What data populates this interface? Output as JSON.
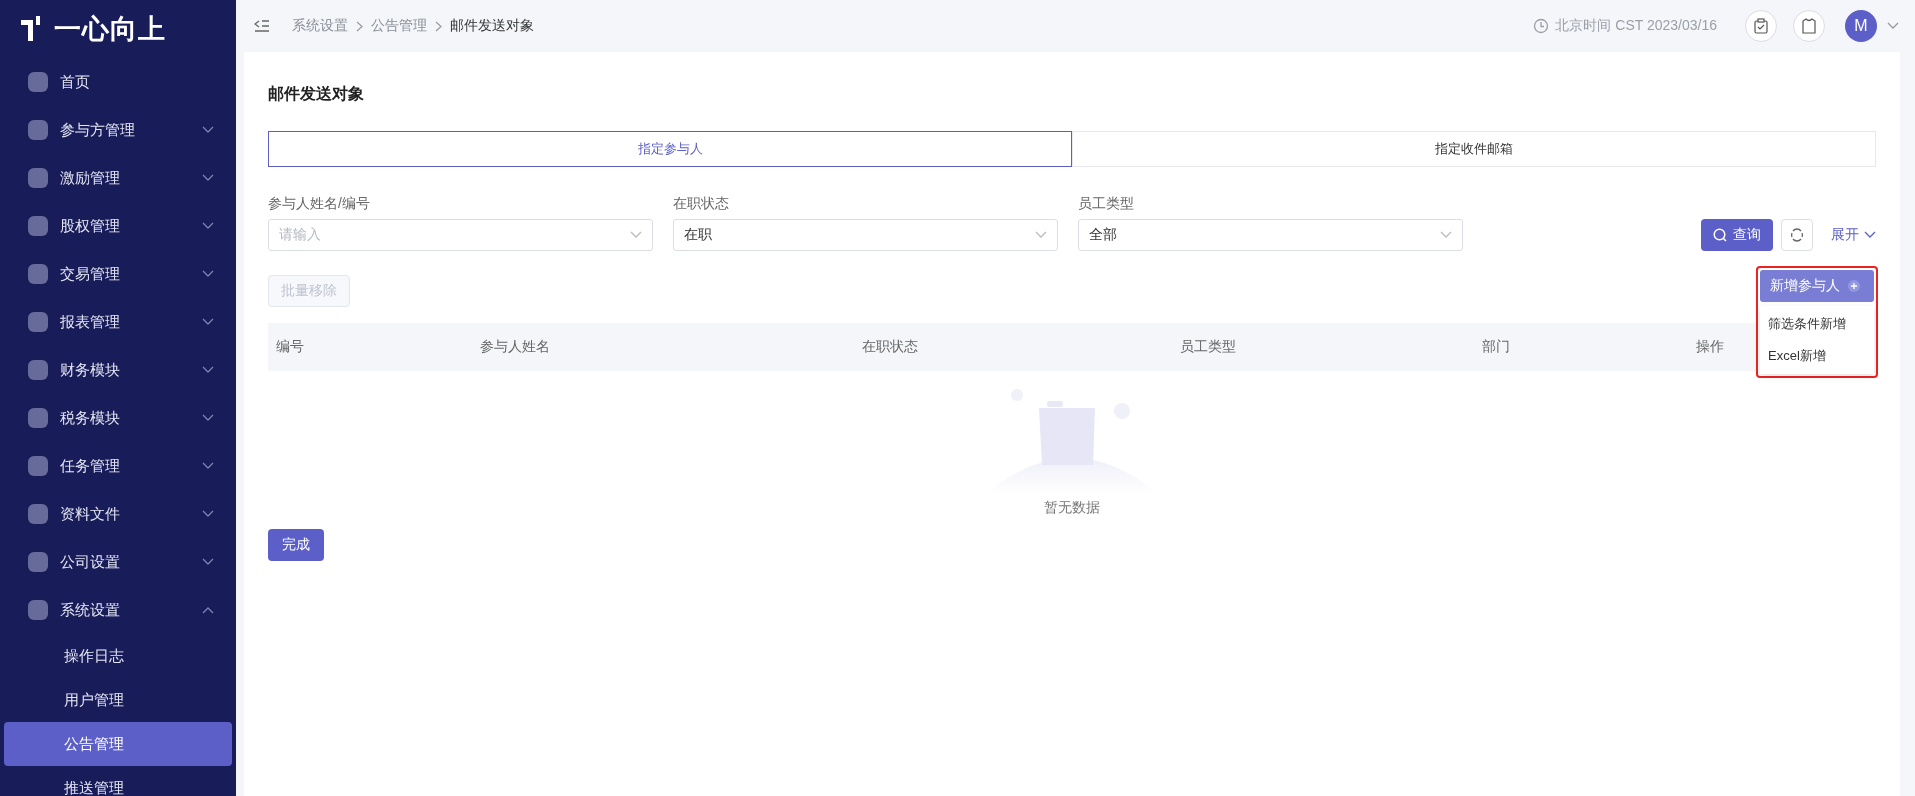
{
  "logo": {
    "text": "一心向上"
  },
  "sidebar": {
    "items": [
      {
        "label": "首页",
        "expandable": false
      },
      {
        "label": "参与方管理",
        "expandable": true,
        "expanded": false
      },
      {
        "label": "激励管理",
        "expandable": true,
        "expanded": false
      },
      {
        "label": "股权管理",
        "expandable": true,
        "expanded": false
      },
      {
        "label": "交易管理",
        "expandable": true,
        "expanded": false
      },
      {
        "label": "报表管理",
        "expandable": true,
        "expanded": false
      },
      {
        "label": "财务模块",
        "expandable": true,
        "expanded": false
      },
      {
        "label": "税务模块",
        "expandable": true,
        "expanded": false
      },
      {
        "label": "任务管理",
        "expandable": true,
        "expanded": false
      },
      {
        "label": "资料文件",
        "expandable": true,
        "expanded": false
      },
      {
        "label": "公司设置",
        "expandable": true,
        "expanded": false
      },
      {
        "label": "系统设置",
        "expandable": true,
        "expanded": true,
        "children": [
          {
            "label": "操作日志",
            "selected": false
          },
          {
            "label": "用户管理",
            "selected": false
          },
          {
            "label": "公告管理",
            "selected": true
          },
          {
            "label": "推送管理",
            "selected": false
          }
        ]
      }
    ]
  },
  "header": {
    "breadcrumbs": [
      "系统设置",
      "公告管理",
      "邮件发送对象"
    ],
    "time": "北京时间 CST 2023/03/16",
    "avatar": "M"
  },
  "page": {
    "title": "邮件发送对象",
    "tabs": [
      {
        "label": "指定参与人",
        "selected": true
      },
      {
        "label": "指定收件邮箱",
        "selected": false
      }
    ],
    "filters": [
      {
        "label": "参与人姓名/编号",
        "placeholder": "请输入"
      },
      {
        "label": "在职状态",
        "value": "在职"
      },
      {
        "label": "员工类型",
        "value": "全部"
      }
    ],
    "query_button": "查询",
    "expand_link": "展开",
    "bulk_remove": {
      "label": "批量移除",
      "disabled": true
    },
    "add_menu": {
      "button": "新增参与人",
      "items": [
        "筛选条件新增",
        "Excel新增"
      ]
    },
    "table": {
      "columns": [
        "编号",
        "参与人姓名",
        "在职状态",
        "员工类型",
        "部门",
        "操作"
      ],
      "empty_text": "暂无数据"
    },
    "done_button": "完成"
  }
}
